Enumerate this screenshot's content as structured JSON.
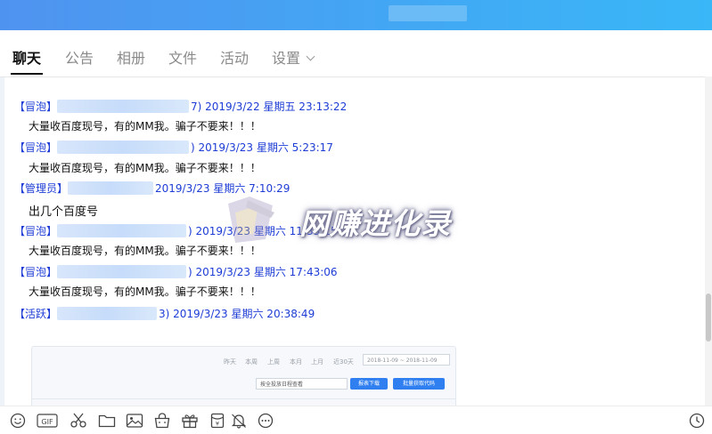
{
  "tabs": [
    {
      "label": "聊天",
      "active": true
    },
    {
      "label": "公告"
    },
    {
      "label": "相册"
    },
    {
      "label": "文件"
    },
    {
      "label": "活动"
    },
    {
      "label": "设置"
    }
  ],
  "messages": [
    {
      "role": "【冒泡】",
      "meta": "7) 2019/3/22 星期五 23:13:22",
      "text": "大量收百度现号，有的MM我。骗子不要来！！！"
    },
    {
      "role": "【冒泡】",
      "meta": ") 2019/3/23 星期六 5:23:17",
      "text": "大量收百度现号，有的MM我。骗子不要来！！！"
    },
    {
      "role": "【管理员】",
      "meta": "2019/3/23 星期六 7:10:29",
      "text": "出几个百度号"
    },
    {
      "role": "【冒泡】",
      "meta": ") 2019/3/23 星期六 11:33:15",
      "text": "大量收百度现号，有的MM我。骗子不要来！！！"
    },
    {
      "role": "【冒泡】",
      "meta": ") 2019/3/23 星期六 17:43:06",
      "text": "大量收百度现号，有的MM我。骗子不要来！！！"
    },
    {
      "role": "【活跃】",
      "meta": "3) 2019/3/23 星期六 20:38:49",
      "text": ""
    }
  ],
  "watermark": {
    "text": "网赚进化录"
  },
  "embedded_screenshot": {
    "periods": [
      "昨天",
      "本周",
      "上周",
      "本月",
      "上月",
      "近30天"
    ],
    "date_range": "2018-11-09 ~ 2018-11-09",
    "select_label": "按全投放日程查看",
    "buttons": [
      "报表下载",
      "批量获取代码"
    ]
  },
  "toolbar_icons": [
    "emoji-icon",
    "gif-icon",
    "scissors-icon",
    "folder-icon",
    "image-icon",
    "gift-bag-icon",
    "gift-icon",
    "red-packet-icon",
    "bell-icon",
    "more-icon",
    "history-icon"
  ]
}
